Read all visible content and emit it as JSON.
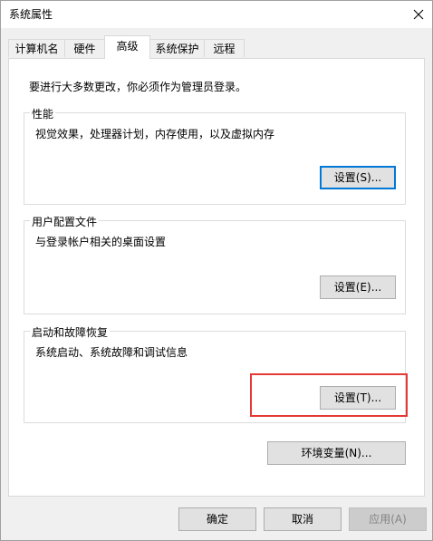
{
  "window": {
    "title": "系统属性"
  },
  "tabs": [
    {
      "label": "计算机名",
      "active": false
    },
    {
      "label": "硬件",
      "active": false
    },
    {
      "label": "高级",
      "active": true
    },
    {
      "label": "系统保护",
      "active": false
    },
    {
      "label": "远程",
      "active": false
    }
  ],
  "advanced": {
    "intro": "要进行大多数更改，你必须作为管理员登录。",
    "performance": {
      "title": "性能",
      "description": "视觉效果，处理器计划，内存使用，以及虚拟内存",
      "button": "设置(S)..."
    },
    "user_profiles": {
      "title": "用户配置文件",
      "description": "与登录帐户相关的桌面设置",
      "button": "设置(E)..."
    },
    "startup_recovery": {
      "title": "启动和故障恢复",
      "description": "系统启动、系统故障和调试信息",
      "button": "设置(T)..."
    },
    "env_button": "环境变量(N)..."
  },
  "footer": {
    "ok": "确定",
    "cancel": "取消",
    "apply": "应用(A)"
  },
  "colors": {
    "focus_border": "#0078d7",
    "highlight_annotation": "#e53935"
  },
  "icons": {
    "close": "close-icon"
  }
}
